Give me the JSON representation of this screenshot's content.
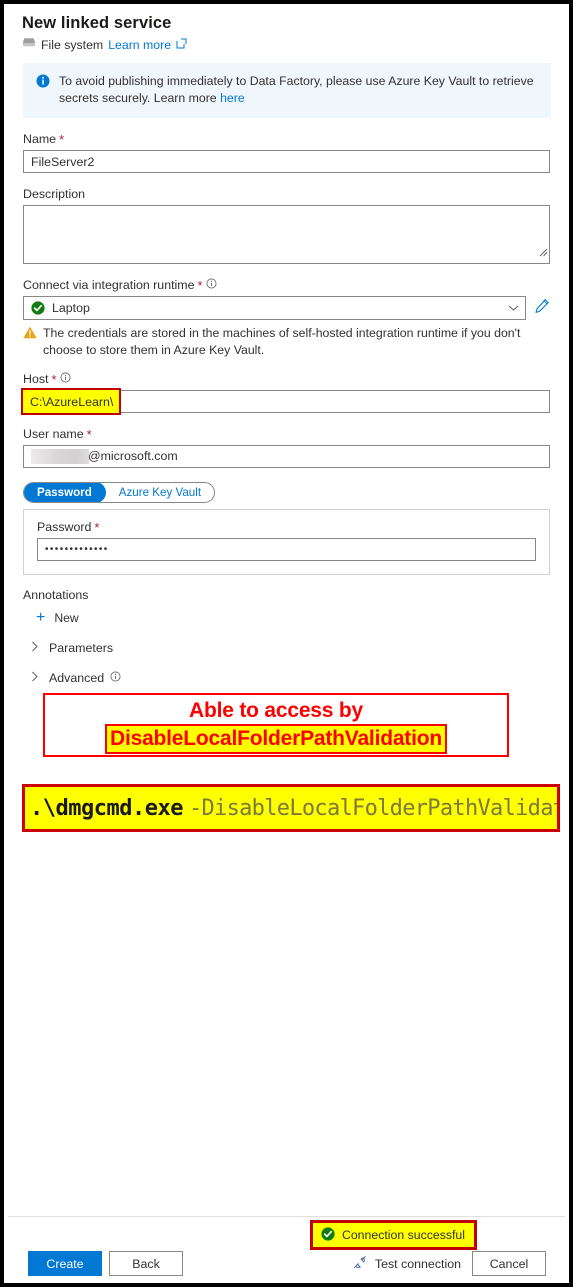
{
  "header": {
    "title": "New linked service",
    "connector_label": "File system",
    "learn_more": "Learn more",
    "fileserver_icon": "file-server-icon",
    "external_link_icon": "external-link-icon"
  },
  "banner": {
    "icon": "info-icon",
    "text_before_link": "To avoid publishing immediately to Data Factory, please use Azure Key Vault to retrieve secrets securely. Learn more ",
    "link_text": "here"
  },
  "form": {
    "name": {
      "label": "Name",
      "required": "*",
      "value": "FileServer2"
    },
    "description": {
      "label": "Description",
      "value": ""
    },
    "integration_runtime": {
      "label": "Connect via integration runtime",
      "required": "*",
      "info_icon": "info-circle-icon",
      "value": "Laptop",
      "status_icon": "green-check-icon",
      "chevron_icon": "chevron-down-icon",
      "edit_icon": "pencil-edit-icon"
    },
    "warning": {
      "icon": "warning-triangle-icon",
      "text": "The credentials are stored in the machines of self-hosted integration runtime if you don't choose to store them in Azure Key Vault."
    },
    "host": {
      "label": "Host",
      "required": "*",
      "info_icon": "info-circle-icon",
      "value": "C:\\AzureLearn\\",
      "highlight_color": "#ffff00",
      "highlight_border_color": "#c00000"
    },
    "user_name": {
      "label": "User name",
      "required": "*",
      "value": "@microsoft.com",
      "redacted": "redacted-username"
    },
    "credential_toggle": {
      "options": [
        "Password",
        "Azure Key Vault"
      ],
      "selected": "Password",
      "accent_color": "#0078d4"
    },
    "password": {
      "label": "Password",
      "required": "*",
      "value": "•••••••••••••"
    },
    "annotations": {
      "label": "Annotations",
      "new_label": "New",
      "plus_icon": "plus-icon"
    },
    "parameters": {
      "label": "Parameters",
      "chevron_icon": "chevron-right-icon"
    },
    "advanced": {
      "label": "Advanced",
      "chevron_icon": "chevron-right-icon",
      "info_icon": "info-circle-icon"
    }
  },
  "callout": {
    "line1": "Able to access by",
    "line2": "DisableLocalFolderPathValidation",
    "color": "#ff0000",
    "highlight": "#ffff00"
  },
  "command": {
    "exe": ".\\dmgcmd.exe",
    "arg": "-DisableLocalFolderPathValidation",
    "background": "#ffff00",
    "border": "#cc0000"
  },
  "footer": {
    "create_label": "Create",
    "back_label": "Back",
    "test_connection_label": "Test connection",
    "test_connection_icon": "plug-connection-icon",
    "cancel_label": "Cancel",
    "connection_status": "Connection successful",
    "connection_status_icon": "green-check-icon"
  }
}
